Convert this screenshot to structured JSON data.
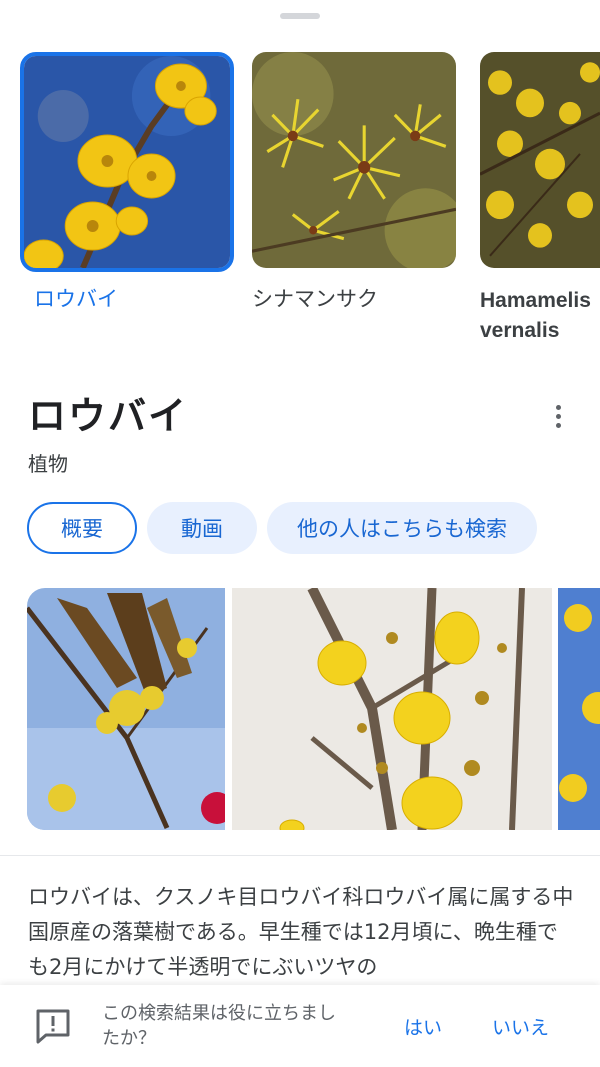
{
  "carousel": {
    "items": [
      {
        "label": "ロウバイ",
        "selected": true
      },
      {
        "label": "シナマンサク",
        "selected": false
      },
      {
        "label": "Hamamelis vernalis",
        "selected": false
      }
    ]
  },
  "entity": {
    "title": "ロウバイ",
    "type": "植物",
    "more_icon": "more-vert-icon"
  },
  "chips": [
    {
      "label": "概要",
      "active": true
    },
    {
      "label": "動画",
      "active": false
    },
    {
      "label": "他の人はこちらも検索",
      "active": false
    }
  ],
  "description": "ロウバイは、クスノキ目ロウバイ科ロウバイ属に属する中国原産の落葉樹である。早生種では12月頃に、晩生種でも2月にかけて半透明でにぶいツヤの",
  "feedback": {
    "icon": "feedback-icon",
    "question": "この検索結果は役に立ちましたか？",
    "yes_label": "はい",
    "no_label": "いいえ"
  },
  "colors": {
    "accent": "#1a73e8",
    "chip_bg": "#e8f0fe",
    "flower_yellow": "#f5c518",
    "sky_blue": "#2d5fb8"
  }
}
